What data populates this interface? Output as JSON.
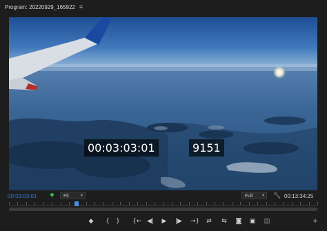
{
  "panel": {
    "title": "Program: 20220929_165922",
    "menu_icon": "hamburger-menu-icon"
  },
  "monitor": {
    "overlay_timecode": "00:03:03:01",
    "overlay_frame": "9151"
  },
  "controls": {
    "current_timecode": "00:03:03:01",
    "zoom_level": "Fit",
    "quality": "Full",
    "duration_timecode": "00:13:34:25"
  },
  "timeline": {
    "playhead_fraction": 0.22
  },
  "transport": {
    "buttons": [
      {
        "name": "add-marker",
        "icon": "marker-icon",
        "glyph": "◆"
      },
      {
        "name": "mark-in",
        "icon": "mark-in-icon",
        "glyph": "{"
      },
      {
        "name": "mark-out",
        "icon": "mark-out-icon",
        "glyph": "}"
      },
      {
        "name": "go-to-in",
        "icon": "go-to-in-icon",
        "glyph": "{←"
      },
      {
        "name": "step-back",
        "icon": "step-back-icon",
        "glyph": "◀|"
      },
      {
        "name": "play",
        "icon": "play-icon",
        "glyph": "▶"
      },
      {
        "name": "step-forward",
        "icon": "step-forward-icon",
        "glyph": "|▶"
      },
      {
        "name": "go-to-out",
        "icon": "go-to-out-icon",
        "glyph": "→}"
      },
      {
        "name": "insert",
        "icon": "insert-icon",
        "glyph": "⇄"
      },
      {
        "name": "overwrite",
        "icon": "overwrite-icon",
        "glyph": "⇆"
      },
      {
        "name": "export-frame",
        "icon": "camera-icon",
        "glyph": "◙"
      },
      {
        "name": "comparison-view",
        "icon": "comparison-view-icon",
        "glyph": "▣"
      },
      {
        "name": "toggle-proxies",
        "icon": "proxy-icon",
        "glyph": "◫"
      },
      {
        "name": "button-editor",
        "icon": "plus-icon",
        "glyph": "+"
      }
    ]
  }
}
